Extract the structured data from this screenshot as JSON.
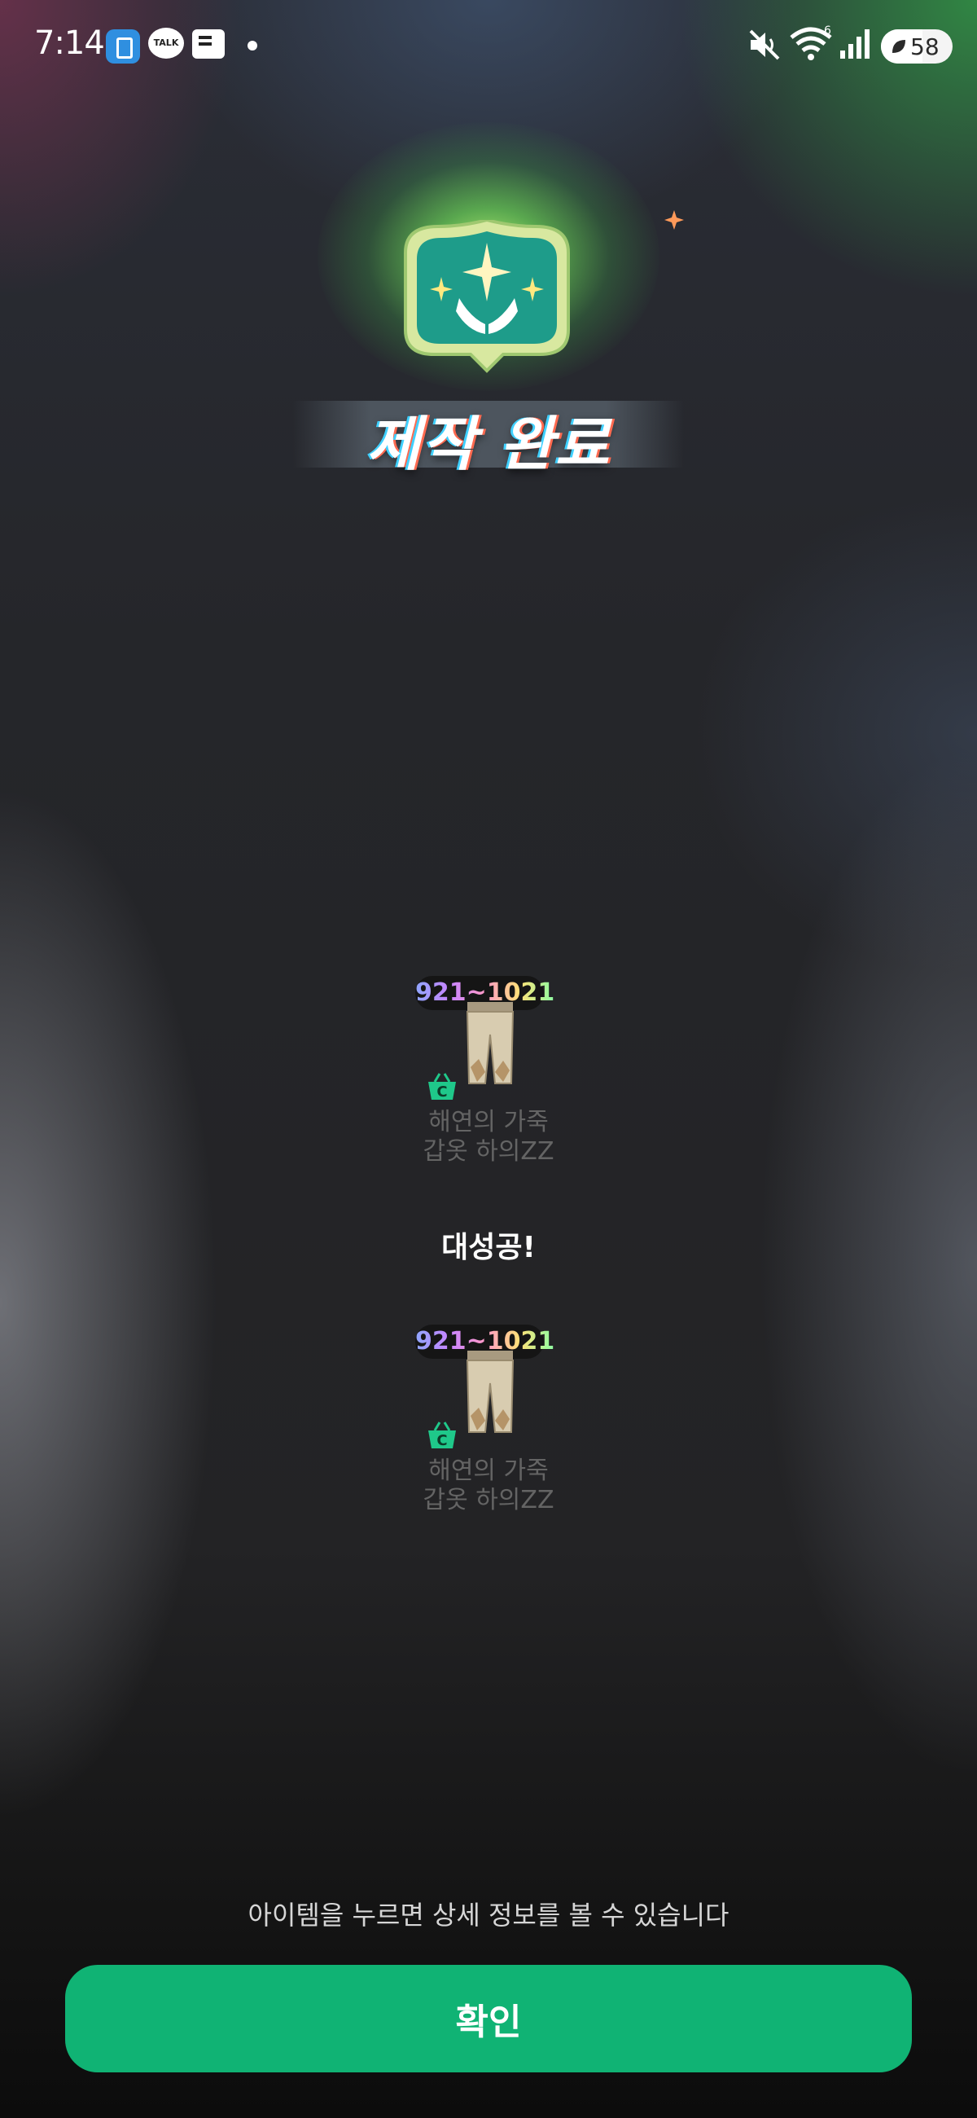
{
  "status_bar": {
    "time": "7:14",
    "talk_label": "TALK",
    "battery": "58",
    "wifi_badge": "6"
  },
  "header": {
    "title": "제작 완료",
    "emblem_icon": "praying-hands-emblem-icon"
  },
  "results": {
    "items": [
      {
        "level_range": "921~1021",
        "name_line1": "해연의 가죽",
        "name_line2": "갑옷 하의ZZ",
        "icon": "leather-pants-icon",
        "shop_badge": "C"
      },
      {
        "level_range": "921~1021",
        "name_line1": "해연의 가죽",
        "name_line2": "갑옷 하의ZZ",
        "icon": "leather-pants-icon",
        "shop_badge": "C"
      }
    ],
    "success_text": "대성공!"
  },
  "footer": {
    "hint": "아이템을 누르면 상세 정보를 볼 수 있습니다",
    "confirm_label": "확인"
  },
  "colors": {
    "accent": "#10b374",
    "item_name": "#646464"
  }
}
